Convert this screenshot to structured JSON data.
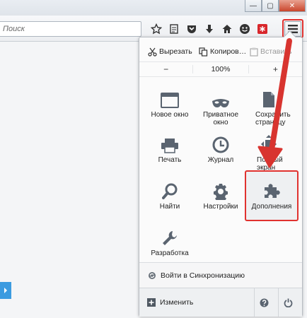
{
  "window": {
    "minimize": "—",
    "maximize": "▢",
    "close": "✕"
  },
  "search": {
    "placeholder": "Поиск"
  },
  "toolbar_icons": [
    "star-icon",
    "reading-list-icon",
    "pocket-icon",
    "download-icon",
    "home-icon",
    "emoji-icon",
    "addon-red-icon"
  ],
  "menu": {
    "edit": {
      "cut": "Вырезать",
      "copy": "Копиров…",
      "paste": "Вставить"
    },
    "zoom": {
      "minus": "−",
      "value": "100%",
      "plus": "+"
    },
    "items": [
      {
        "label": "Новое окно"
      },
      {
        "label": "Приватное окно"
      },
      {
        "label": "Сохранить страницу"
      },
      {
        "label": "Печать"
      },
      {
        "label": "Журнал"
      },
      {
        "label": "Полный экран"
      },
      {
        "label": "Найти"
      },
      {
        "label": "Настройки"
      },
      {
        "label": "Дополнения"
      },
      {
        "label": "Разработка"
      }
    ],
    "sync": "Войти в Синхронизацию",
    "customize": "Изменить"
  },
  "colors": {
    "highlight": "#e0322f",
    "accent_blue": "#3c9be0",
    "icon_gray": "#5a6470"
  }
}
